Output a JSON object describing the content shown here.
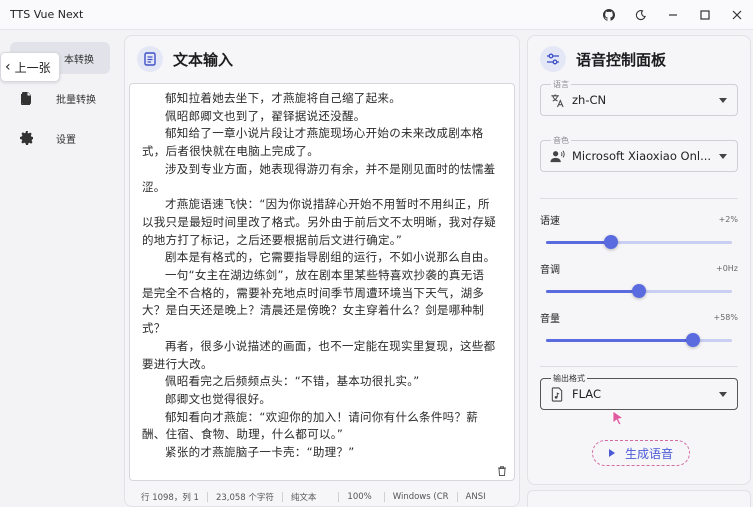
{
  "app": {
    "title": "TTS Vue Next"
  },
  "titlebar": {
    "icons": [
      "github-icon",
      "moon-icon",
      "minimize-icon",
      "maximize-icon",
      "close-icon"
    ]
  },
  "sidebar": {
    "items": [
      {
        "label": "本转换",
        "icon": "text-convert-icon",
        "active": true
      },
      {
        "label": "批量转换",
        "icon": "document-icon",
        "active": false
      },
      {
        "label": "设置",
        "icon": "gear-icon",
        "active": false
      }
    ],
    "back_label": "上一张"
  },
  "text_panel": {
    "title": "文本输入",
    "paragraphs": [
      "郁知拉着她去坐下，才燕旎将自己缩了起来。",
      "佩昭郎卿文也到了，翟铎据说还没醒。",
      "郁知给了一章小说片段让才燕旎现场心开始の未来改成剧本格式，后者很快就在电脑上完成了。",
      "涉及到专业方面，她表现得游刃有余，并不是刚见面时的怯懦羞涩。",
      "才燕旎语速飞快：“因为你说措辞心开始不用暂时不用纠正，所以我只是最短时间里改了格式。另外由于前后文不太明晰，我对存疑的地方打了标记，之后还要根据前后文进行确定。”",
      "剧本是有格式的，它需要指导剧组的运行，不如小说那么自由。",
      "一句“女主在湖边练剑”，放在剧本里某些特喜欢抄袭的真无语是完全不合格的，需要补充地点时间季节周遭环境当下天气，湖多大？是白天还是晚上？清晨还是傍晚？女主穿着什么？剑是哪种制式？",
      "再者，很多小说描述的画面，也不一定能在现实里复现，这些都要进行大改。",
      "佩昭看完之后频频点头：“不错，基本功很扎实。”",
      "郎卿文也觉得很好。",
      "郁知看向才燕旎：“欢迎你的加入！请问你有什么条件吗？薪酬、住宿、食物、助理，什么都可以。”",
      "紧张的才燕旎脑子一卡壳：“助理？”"
    ],
    "status": {
      "position": "行 1098，列 1",
      "chars": "23,058 个字符",
      "format": "纯文本",
      "zoom": "100%",
      "line_ending": "Windows (CR",
      "encoding": "ANSI"
    }
  },
  "voice_panel": {
    "title": "语音控制面板",
    "language": {
      "label": "语言",
      "value": "zh-CN"
    },
    "voice": {
      "label": "音色",
      "value": "Microsoft Xiaoxiao Onl..."
    },
    "sliders": [
      {
        "label": "语速",
        "display": "+2%",
        "level": 0.35
      },
      {
        "label": "音调",
        "display": "+0Hz",
        "level": 0.5
      },
      {
        "label": "音量",
        "display": "+58%",
        "level": 0.79
      }
    ],
    "format": {
      "label": "输出格式",
      "value": "FLAC"
    },
    "generate_label": "生成语音"
  },
  "colors": {
    "accent": "#5a6be0",
    "accent_light": "#c9cef2",
    "button_border": "#d36aa3"
  }
}
